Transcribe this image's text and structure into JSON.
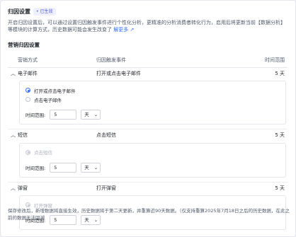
{
  "header": {
    "title": "归因设置",
    "badge": "已生效"
  },
  "description": "开启归因设置后，可以通过设置归因触发事件进行个性化分析，更精准的分析消费者转化行为，启用后将更新当前【数据分析】等模块的计算方式，历史数据可能会发生改变了",
  "learn_more": "解更多",
  "section_title": "营销归因设置",
  "columns": {
    "method": "营销方式",
    "event": "归因触发事件",
    "window": "时间范围"
  },
  "rows": [
    {
      "name": "电子邮件",
      "event": "打开或点击电子邮件",
      "window": "5 天",
      "options": [
        "打开或点击电子邮件",
        "点击电子邮件"
      ],
      "range_label": "时间范围:",
      "range_value": "5",
      "range_unit": "天"
    },
    {
      "name": "短信",
      "event": "点击短信",
      "window": "5 天",
      "options": [
        "点击短信"
      ],
      "range_label": "时间范围:",
      "range_value": "5",
      "range_unit": "天"
    },
    {
      "name": "弹窗",
      "event": "打开弹窗",
      "window": "5 天",
      "options": [
        "打开弹窗"
      ],
      "range_label": "时间范围:",
      "range_value": "5",
      "range_unit": "天"
    }
  ],
  "footer": "保存修改后，新增数据将直接生效，历史数据将于第二天更新，并重算近90天数据。（仅支持重算2025年7月18日之后的历史数据，在此之前的数据无法回溯",
  "colors": {
    "accent": "#3370ff",
    "badge_bg": "#eef0ff"
  }
}
